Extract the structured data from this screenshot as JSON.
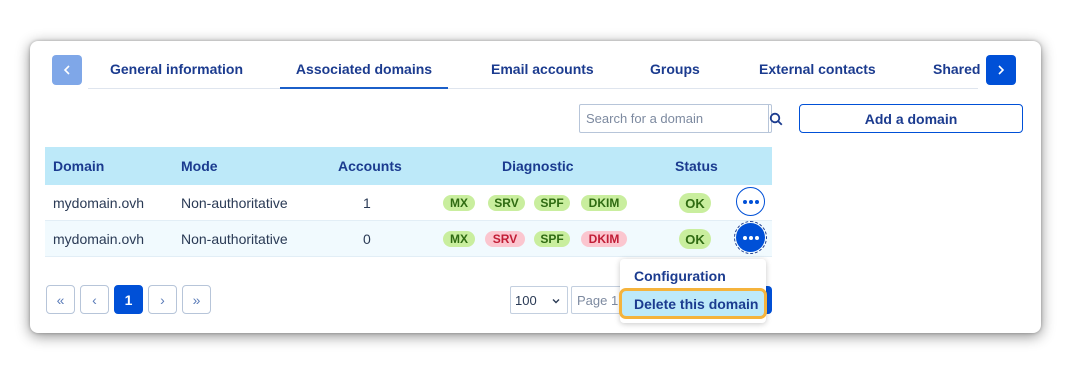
{
  "tabs": {
    "items": [
      {
        "label": "General information"
      },
      {
        "label": "Associated domains"
      },
      {
        "label": "Email accounts"
      },
      {
        "label": "Groups"
      },
      {
        "label": "External contacts"
      },
      {
        "label": "Shared"
      }
    ],
    "active": "Associated domains",
    "prev_icon": "chevron-left-icon",
    "next_icon": "chevron-right-icon"
  },
  "search": {
    "placeholder": "Search for a domain",
    "icon": "search-icon"
  },
  "add_domain": {
    "label": "Add a domain"
  },
  "table": {
    "headers": {
      "domain": "Domain",
      "mode": "Mode",
      "accounts": "Accounts",
      "diagnostic": "Diagnostic",
      "status": "Status"
    },
    "rows": [
      {
        "domain": "mydomain.ovh",
        "mode": "Non-authoritative",
        "accounts": "1",
        "diagnostics": [
          {
            "label": "MX",
            "state": "ok"
          },
          {
            "label": "SRV",
            "state": "ok"
          },
          {
            "label": "SPF",
            "state": "ok"
          },
          {
            "label": "DKIM",
            "state": "ok"
          }
        ],
        "status": "OK"
      },
      {
        "domain": "mydomain.ovh",
        "mode": "Non-authoritative",
        "accounts": "0",
        "diagnostics": [
          {
            "label": "MX",
            "state": "ok"
          },
          {
            "label": "SRV",
            "state": "error"
          },
          {
            "label": "SPF",
            "state": "ok"
          },
          {
            "label": "DKIM",
            "state": "error"
          }
        ],
        "status": "OK"
      }
    ]
  },
  "pagination": {
    "first": "«",
    "prev": "‹",
    "current": "1",
    "next": "›",
    "last": "»",
    "per_page": "100",
    "page_placeholder": "Page 1"
  },
  "menu": {
    "items": [
      {
        "label": "Configuration"
      },
      {
        "label": "Delete this domain"
      }
    ],
    "highlighted": "Delete this domain"
  },
  "colors": {
    "primary": "#0050d7",
    "heading_text": "#1b3b8f",
    "table_header_bg": "#bde9f9",
    "ok_badge": "#c9ee9e",
    "error_badge": "#fbc6cf",
    "highlight_outline": "#f5b33c"
  }
}
